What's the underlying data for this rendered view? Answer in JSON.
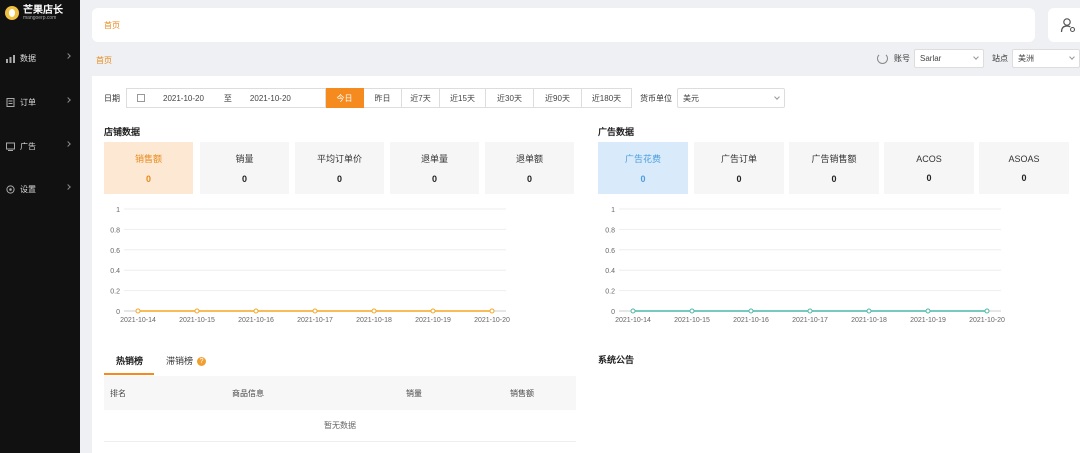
{
  "sidebar": {
    "logo_title": "芒果店长",
    "logo_subtitle": "mangoerp.com",
    "items": [
      {
        "label": "数据",
        "icon": "bar-chart-icon"
      },
      {
        "label": "订单",
        "icon": "document-icon"
      },
      {
        "label": "广告",
        "icon": "megaphone-icon"
      },
      {
        "label": "设置",
        "icon": "gear-icon"
      }
    ]
  },
  "header": {
    "breadcrumb": "首页",
    "user_icon": "user-settings-icon"
  },
  "page": {
    "breadcrumb": "首页"
  },
  "account": {
    "label": "账号",
    "value": "Sarlar",
    "site_label": "站点",
    "site_value": "美洲"
  },
  "filters": {
    "date_label": "日期",
    "start_date": "2021-10-20",
    "to": "至",
    "end_date": "2021-10-20",
    "ranges": [
      "今日",
      "昨日",
      "近7天",
      "近15天",
      "近30天",
      "近90天",
      "近180天"
    ],
    "active_range": "今日",
    "currency_label": "货币单位",
    "currency_value": "美元"
  },
  "store": {
    "title": "店铺数据",
    "cards": [
      {
        "label": "销售额",
        "value": "0"
      },
      {
        "label": "销量",
        "value": "0"
      },
      {
        "label": "平均订单价",
        "value": "0"
      },
      {
        "label": "退单量",
        "value": "0"
      },
      {
        "label": "退单额",
        "value": "0"
      }
    ]
  },
  "ads": {
    "title": "广告数据",
    "cards": [
      {
        "label": "广告花费",
        "value": "0"
      },
      {
        "label": "广告订单",
        "value": "0"
      },
      {
        "label": "广告销售额",
        "value": "0"
      },
      {
        "label": "ACOS",
        "value": "0"
      },
      {
        "label": "ASOAS",
        "value": "0"
      }
    ]
  },
  "colors": {
    "accent": "#f58a1f",
    "ad_accent": "#4ab8a8"
  },
  "chart_data": [
    {
      "type": "line",
      "x": [
        "2021-10-14",
        "2021-10-15",
        "2021-10-16",
        "2021-10-17",
        "2021-10-18",
        "2021-10-19",
        "2021-10-20"
      ],
      "series": [
        {
          "values": [
            0,
            0,
            0,
            0,
            0,
            0,
            0
          ]
        }
      ],
      "yticks": [
        "1",
        "0.8",
        "0.6",
        "0.4",
        "0.2",
        "0"
      ],
      "ylim": [
        0,
        1
      ],
      "grid": true,
      "color": "#f5a623"
    },
    {
      "type": "line",
      "x": [
        "2021-10-14",
        "2021-10-15",
        "2021-10-16",
        "2021-10-17",
        "2021-10-18",
        "2021-10-19",
        "2021-10-20"
      ],
      "series": [
        {
          "values": [
            0,
            0,
            0,
            0,
            0,
            0,
            0
          ]
        }
      ],
      "yticks": [
        "1",
        "0.8",
        "0.6",
        "0.4",
        "0.2",
        "0"
      ],
      "ylim": [
        0,
        1
      ],
      "grid": true,
      "color": "#4ab8a8"
    }
  ],
  "rankings": {
    "tabs": [
      "热销榜",
      "滞销榜"
    ],
    "help": "?",
    "columns": [
      "排名",
      "商品信息",
      "销量",
      "销售额"
    ],
    "empty_text": "暂无数据"
  },
  "announcements": {
    "title": "系统公告"
  }
}
